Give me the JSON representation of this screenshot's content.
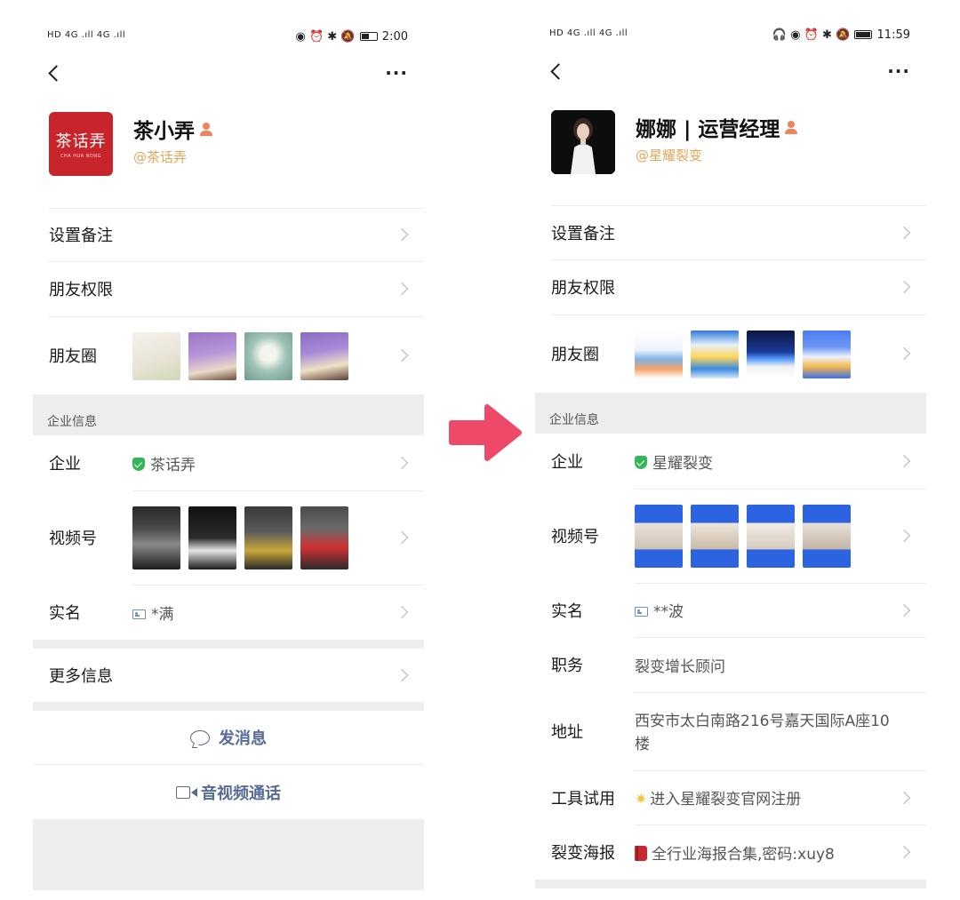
{
  "left": {
    "status": {
      "signal_text": "HD 4G .ıll 4G .ıll",
      "time": "2:00"
    },
    "profile": {
      "name": "茶小弄",
      "company_tag": "@茶话弄",
      "logo_text": "茶话弄",
      "logo_sub": "CHA HUA NONG"
    },
    "rows": {
      "remark": "设置备注",
      "permissions": "朋友权限",
      "moments": "朋友圈"
    },
    "section_title": "企业信息",
    "enterprise": {
      "label": "企业",
      "value": "茶话弄"
    },
    "channels": {
      "label": "视频号"
    },
    "realname": {
      "label": "实名",
      "value": "*满"
    },
    "more": {
      "label": "更多信息"
    },
    "actions": {
      "message": "发消息",
      "call": "音视频通话"
    }
  },
  "right": {
    "status": {
      "signal_text": "HD 4G .ıll 4G .ıll",
      "time": "11:59"
    },
    "profile": {
      "name": "娜娜 | 运营经理",
      "company_tag": "@星耀裂变"
    },
    "rows": {
      "remark": "设置备注",
      "permissions": "朋友权限",
      "moments": "朋友圈"
    },
    "section_title": "企业信息",
    "enterprise": {
      "label": "企业",
      "value": "星耀裂变"
    },
    "channels": {
      "label": "视频号"
    },
    "realname": {
      "label": "实名",
      "value": "**波"
    },
    "position": {
      "label": "职务",
      "value": "裂变增长顾问"
    },
    "address": {
      "label": "地址",
      "line1": "西安市太白南路216号嘉天国际A座10",
      "line2": "楼"
    },
    "tool_trial": {
      "label": "工具试用",
      "value": "进入星耀裂变官网注册"
    },
    "poster": {
      "label": "裂变海报",
      "value": "全行业海报合集,密码:xuy8"
    }
  },
  "colors": {
    "accent": "#576b95",
    "verified": "#35b55a",
    "tag": "#e3a55a",
    "arrow": "#ee4968",
    "band": "#ededed"
  }
}
